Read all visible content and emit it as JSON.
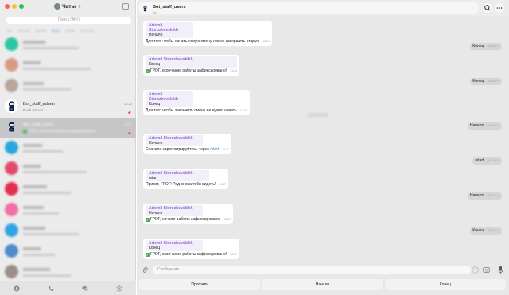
{
  "window": {
    "title": "Чаты"
  },
  "sidebar": {
    "search_placeholder": "Поиск (⌘K)",
    "folders": [
      "Все",
      "Личные",
      "Группы",
      "Боты",
      "Архив",
      "Проекты"
    ],
    "chats": [
      {
        "name": "Bot_staff_admin",
        "subtitle": "Push Report",
        "time": "7.12.23"
      },
      {
        "name": "Bot_staff_users",
        "subtitle": "ГРОГ, окончание работы зафиксировано!",
        "time": "13:57"
      }
    ],
    "nav": [
      "contacts",
      "calls",
      "chats",
      "settings"
    ]
  },
  "chat": {
    "title": "Bot_staff_users",
    "status": "бот",
    "composer_placeholder": "Сообщение...",
    "keyboard": [
      "Профиль",
      "Начало",
      "Конец"
    ]
  },
  "messages": {
    "m1": {
      "author": "Artemii Storozhevskikh",
      "quote": "Начало",
      "text": "Для того чтобы начать новую смену нужно завершить старую",
      "time": "13:24"
    },
    "r1": {
      "text": "Конец",
      "time": "13:24"
    },
    "m2": {
      "author": "Artemii Storozhevskikh",
      "quote": "Конец",
      "text": "ГРОГ, окончание работы зафиксировано!",
      "time": "13:24"
    },
    "r2": {
      "text": "Конец",
      "time": "13:24"
    },
    "m3": {
      "author": "Artemii Storozhevskikh",
      "quote": "Конец",
      "text": "Для того чтобы закончить смену ее нужно начать",
      "time": "13:24"
    },
    "r3": {
      "text": "Начало",
      "time": "16:47"
    },
    "m4": {
      "author": "Artemii Storozhevskikh",
      "quote": "Начало",
      "text_prefix": "Сначала зарегистрируйтесь через ",
      "link": "/start",
      "time": "16:47"
    },
    "r4": {
      "text": "/start",
      "time": "16:47"
    },
    "m5": {
      "author": "Artemii Storozhevskikh",
      "quote": "/start",
      "text": "Привет, ГРОГ! Рад снова тебя видеть!",
      "time": "16:47"
    },
    "r5": {
      "text": "Начало",
      "time": "16:57"
    },
    "m6": {
      "author": "Artemii Storozhevskikh",
      "quote": "Начало",
      "text": "ГРОГ, начало работы зафиксировано!",
      "time": "16:57"
    },
    "r6": {
      "text": "Конец",
      "time": "16:57"
    },
    "m7": {
      "author": "Artemii Storozhevskikh",
      "quote": "Конец",
      "text": "ГРОГ, окончание работы зафиксировано!",
      "time": "16:57"
    }
  }
}
